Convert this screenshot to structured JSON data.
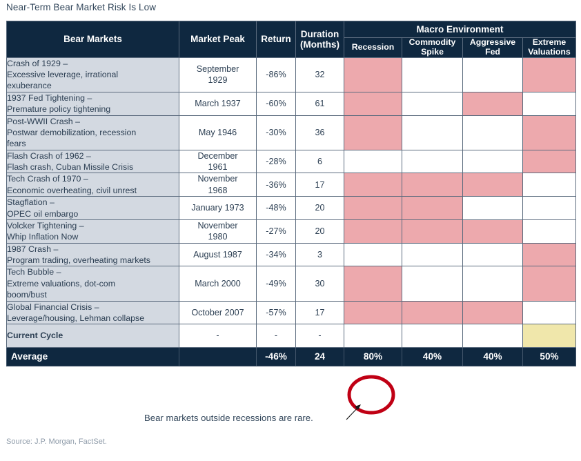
{
  "title": "Near-Term Bear Market Risk Is Low",
  "source_note": "Source: J.P. Morgan, FactSet.",
  "annotation": {
    "text": "Bear markets outside recessions are rare.",
    "highlight_target": "80%",
    "circle_color": "#c00014",
    "arrow_color": "#1a1a1a"
  },
  "colors": {
    "header_navy": "#0f2840",
    "row_label_bg": "#d3d9e1",
    "macro_on": "#eda9ad",
    "macro_warn": "#f0e7ab",
    "grid_line": "#5a6a7d",
    "title_text": "#33475b",
    "source_text": "#8d9aa8"
  },
  "table": {
    "headers": {
      "bear_markets": "Bear Markets",
      "market_peak": "Market Peak",
      "return": "Return",
      "duration": "Duration\n(Months)",
      "duration_line1": "Duration",
      "duration_line2": "(Months)",
      "macro_environment": "Macro Environment",
      "recession": "Recession",
      "commodity_spike_line1": "Commodity",
      "commodity_spike_line2": "Spike",
      "aggressive_fed_line1": "Aggressive",
      "aggressive_fed_line2": "Fed",
      "extreme_valuations_line1": "Extreme",
      "extreme_valuations_line2": "Valuations"
    },
    "rows": [
      {
        "name_line1": "Crash of 1929 –",
        "name_line2": "Excessive leverage, irrational",
        "name_line3": "exuberance",
        "market_peak_line1": "September",
        "market_peak_line2": "1929",
        "return": "-86%",
        "duration": "32",
        "recession": true,
        "commodity_spike": false,
        "aggressive_fed": false,
        "extreme_valuations": true
      },
      {
        "name_line1": "1937 Fed Tightening  –",
        "name_line2": "Premature policy tightening",
        "name_line3": "",
        "market_peak_line1": "March 1937",
        "market_peak_line2": "",
        "return": "-60%",
        "duration": "61",
        "recession": true,
        "commodity_spike": false,
        "aggressive_fed": true,
        "extreme_valuations": false
      },
      {
        "name_line1": "Post-WWII Crash –",
        "name_line2": "Postwar demobilization,  recession",
        "name_line3": "fears",
        "market_peak_line1": "May 1946",
        "market_peak_line2": "",
        "return": "-30%",
        "duration": "36",
        "recession": true,
        "commodity_spike": false,
        "aggressive_fed": false,
        "extreme_valuations": true
      },
      {
        "name_line1": "Flash Crash of 1962 –",
        "name_line2": "Flash crash, Cuban Missile Crisis",
        "name_line3": "",
        "market_peak_line1": "December",
        "market_peak_line2": "1961",
        "return": "-28%",
        "duration": "6",
        "recession": false,
        "commodity_spike": false,
        "aggressive_fed": false,
        "extreme_valuations": true
      },
      {
        "name_line1": "Tech Crash of 1970 –",
        "name_line2": "Economic overheating, civil unrest",
        "name_line3": "",
        "market_peak_line1": "November",
        "market_peak_line2": "1968",
        "return": "-36%",
        "duration": "17",
        "recession": true,
        "commodity_spike": true,
        "aggressive_fed": true,
        "extreme_valuations": false
      },
      {
        "name_line1": "Stagflation  –",
        "name_line2": "OPEC oil embargo",
        "name_line3": "",
        "market_peak_line1": "January 1973",
        "market_peak_line2": "",
        "return": "-48%",
        "duration": "20",
        "recession": true,
        "commodity_spike": true,
        "aggressive_fed": false,
        "extreme_valuations": false
      },
      {
        "name_line1": "Volcker Tightening  –",
        "name_line2": "Whip Inflation Now",
        "name_line3": "",
        "market_peak_line1": "November",
        "market_peak_line2": "1980",
        "return": "-27%",
        "duration": "20",
        "recession": true,
        "commodity_spike": true,
        "aggressive_fed": true,
        "extreme_valuations": false
      },
      {
        "name_line1": "1987 Crash –",
        "name_line2": "Program trading, overheating markets",
        "name_line3": "",
        "market_peak_line1": "August 1987",
        "market_peak_line2": "",
        "return": "-34%",
        "duration": "3",
        "recession": false,
        "commodity_spike": false,
        "aggressive_fed": false,
        "extreme_valuations": true
      },
      {
        "name_line1": "Tech Bubble  –",
        "name_line2": "Extreme valuations,  dot-com",
        "name_line3": "boom/bust",
        "market_peak_line1": "March 2000",
        "market_peak_line2": "",
        "return": "-49%",
        "duration": "30",
        "recession": true,
        "commodity_spike": false,
        "aggressive_fed": false,
        "extreme_valuations": true
      },
      {
        "name_line1": "Global Financial  Crisis –",
        "name_line2": "Leverage/housing, Lehman collapse",
        "name_line3": "",
        "market_peak_line1": "October 2007",
        "market_peak_line2": "",
        "return": "-57%",
        "duration": "17",
        "recession": true,
        "commodity_spike": true,
        "aggressive_fed": true,
        "extreme_valuations": false
      },
      {
        "name_line1": "Current Cycle",
        "name_line2": "",
        "name_line3": "",
        "market_peak_line1": "-",
        "market_peak_line2": "",
        "return": "-",
        "duration": "-",
        "recession": false,
        "commodity_spike": false,
        "aggressive_fed": false,
        "extreme_valuations": "warn"
      }
    ],
    "average_row": {
      "label": "Average",
      "market_peak": "",
      "return": "-46%",
      "duration": "24",
      "recession": "80%",
      "commodity_spike": "40%",
      "aggressive_fed": "40%",
      "extreme_valuations": "50%"
    }
  }
}
